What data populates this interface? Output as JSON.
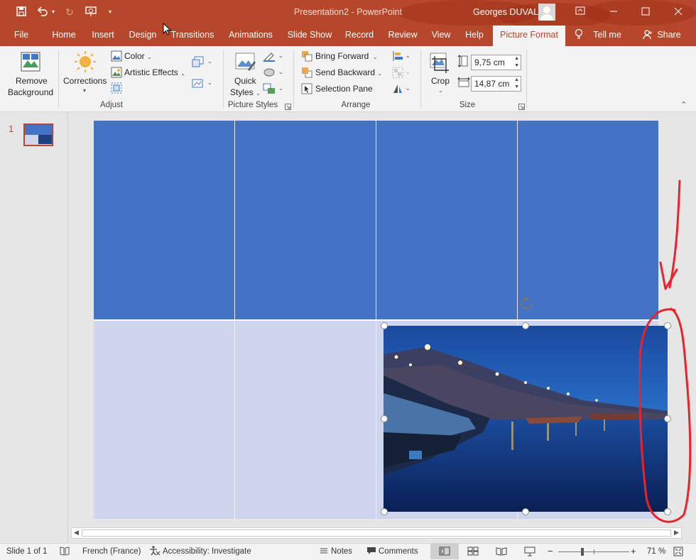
{
  "titlebar": {
    "doc_title": "Presentation2  -  PowerPoint",
    "user_name": "Georges DUVAL"
  },
  "tabs": [
    {
      "label": "File"
    },
    {
      "label": "Home"
    },
    {
      "label": "Insert"
    },
    {
      "label": "Design"
    },
    {
      "label": "Transitions"
    },
    {
      "label": "Animations"
    },
    {
      "label": "Slide Show"
    },
    {
      "label": "Record"
    },
    {
      "label": "Review"
    },
    {
      "label": "View"
    },
    {
      "label": "Help"
    },
    {
      "label": "Picture Format",
      "active": true
    },
    {
      "label": "Tell me"
    },
    {
      "label": "Share"
    }
  ],
  "ribbon": {
    "remove_bg_line1": "Remove",
    "remove_bg_line2": "Background",
    "corrections": "Corrections",
    "color": "Color",
    "artistic_effects": "Artistic Effects",
    "adjust_group": "Adjust",
    "quick_styles_line1": "Quick",
    "quick_styles_line2": "Styles",
    "picture_styles_group": "Picture Styles",
    "bring_forward": "Bring Forward",
    "send_backward": "Send Backward",
    "selection_pane": "Selection Pane",
    "arrange_group": "Arrange",
    "crop": "Crop",
    "height_value": "9,75 cm",
    "width_value": "14,87 cm",
    "size_group": "Size"
  },
  "thumbnails": {
    "slide_number": "1"
  },
  "status": {
    "slide_info": "Slide 1 of 1",
    "language": "French (France)",
    "accessibility": "Accessibility: Investigate",
    "notes": "Notes",
    "comments": "Comments",
    "zoom": "71 %"
  },
  "colors": {
    "accent": "#b7472a",
    "slide_top": "#4472c4",
    "slide_bottom": "#cfd5ea",
    "annotation": "#e8232a"
  }
}
